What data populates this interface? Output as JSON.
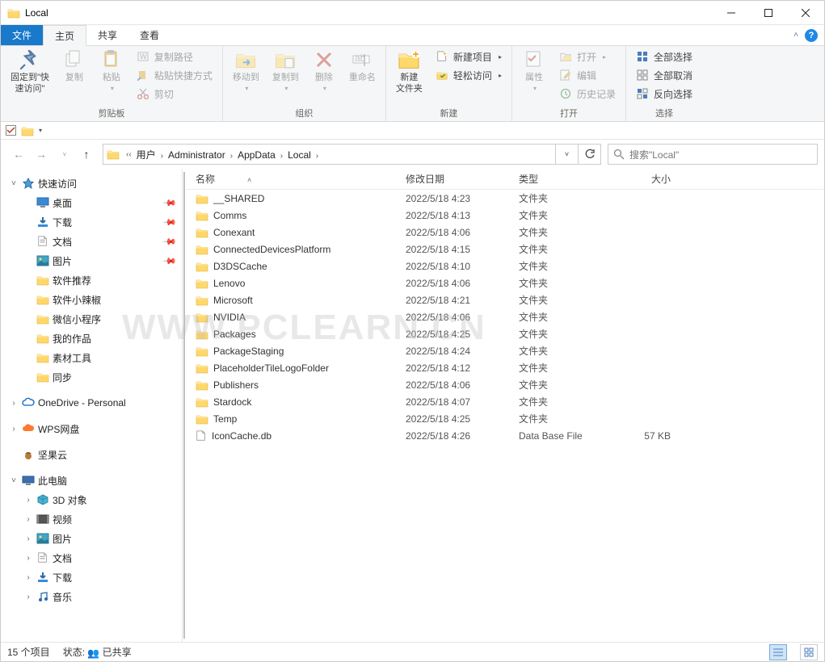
{
  "window": {
    "title": "Local"
  },
  "tabs": {
    "file": "文件",
    "home": "主页",
    "share": "共享",
    "view": "查看"
  },
  "ribbon": {
    "groups": {
      "clipboard": {
        "label": "剪贴板",
        "pin": "固定到\"快\n速访问\"",
        "copy": "复制",
        "paste": "粘贴",
        "copypath": "复制路径",
        "pasteShortcut": "粘贴快捷方式",
        "cut": "剪切"
      },
      "organize": {
        "label": "组织",
        "moveTo": "移动到",
        "copyTo": "复制到",
        "delete": "删除",
        "rename": "重命名"
      },
      "new": {
        "label": "新建",
        "newFolder": "新建\n文件夹",
        "newItem": "新建项目",
        "easyAccess": "轻松访问"
      },
      "open": {
        "label": "打开",
        "properties": "属性",
        "open": "打开",
        "edit": "编辑",
        "history": "历史记录"
      },
      "select": {
        "label": "选择",
        "selectAll": "全部选择",
        "selectNone": "全部取消",
        "invert": "反向选择"
      }
    }
  },
  "breadcrumbs": [
    "用户",
    "Administrator",
    "AppData",
    "Local"
  ],
  "search": {
    "placeholder": "搜索\"Local\""
  },
  "columns": {
    "name": "名称",
    "date": "修改日期",
    "type": "类型",
    "size": "大小"
  },
  "tree": {
    "quickAccess": "快速访问",
    "items": [
      {
        "label": "桌面",
        "icon": "desktop",
        "pinned": true
      },
      {
        "label": "下载",
        "icon": "download",
        "pinned": true
      },
      {
        "label": "文档",
        "icon": "document",
        "pinned": true
      },
      {
        "label": "图片",
        "icon": "pictures",
        "pinned": true
      },
      {
        "label": "软件推荐",
        "icon": "folder",
        "pinned": false
      },
      {
        "label": "软件小辣椒",
        "icon": "folder",
        "pinned": false
      },
      {
        "label": "微信小程序",
        "icon": "folder",
        "pinned": false
      },
      {
        "label": "我的作品",
        "icon": "folder",
        "pinned": false
      },
      {
        "label": "素材工具",
        "icon": "folder",
        "pinned": false
      },
      {
        "label": "同步",
        "icon": "folder",
        "pinned": false
      }
    ],
    "onedrive": "OneDrive - Personal",
    "wps": "WPS网盘",
    "jianguo": "坚果云",
    "thispc": "此电脑",
    "pcItems": [
      {
        "label": "3D 对象",
        "icon": "3d"
      },
      {
        "label": "视频",
        "icon": "video"
      },
      {
        "label": "图片",
        "icon": "pictures"
      },
      {
        "label": "文档",
        "icon": "document"
      },
      {
        "label": "下载",
        "icon": "download"
      },
      {
        "label": "音乐",
        "icon": "music"
      }
    ]
  },
  "files": [
    {
      "name": "__SHARED",
      "date": "2022/5/18 4:23",
      "type": "文件夹",
      "size": "",
      "icon": "folder"
    },
    {
      "name": "Comms",
      "date": "2022/5/18 4:13",
      "type": "文件夹",
      "size": "",
      "icon": "folder"
    },
    {
      "name": "Conexant",
      "date": "2022/5/18 4:06",
      "type": "文件夹",
      "size": "",
      "icon": "folder"
    },
    {
      "name": "ConnectedDevicesPlatform",
      "date": "2022/5/18 4:15",
      "type": "文件夹",
      "size": "",
      "icon": "folder"
    },
    {
      "name": "D3DSCache",
      "date": "2022/5/18 4:10",
      "type": "文件夹",
      "size": "",
      "icon": "folder"
    },
    {
      "name": "Lenovo",
      "date": "2022/5/18 4:06",
      "type": "文件夹",
      "size": "",
      "icon": "folder"
    },
    {
      "name": "Microsoft",
      "date": "2022/5/18 4:21",
      "type": "文件夹",
      "size": "",
      "icon": "folder"
    },
    {
      "name": "NVIDIA",
      "date": "2022/5/18 4:06",
      "type": "文件夹",
      "size": "",
      "icon": "folder"
    },
    {
      "name": "Packages",
      "date": "2022/5/18 4:25",
      "type": "文件夹",
      "size": "",
      "icon": "folder"
    },
    {
      "name": "PackageStaging",
      "date": "2022/5/18 4:24",
      "type": "文件夹",
      "size": "",
      "icon": "folder"
    },
    {
      "name": "PlaceholderTileLogoFolder",
      "date": "2022/5/18 4:12",
      "type": "文件夹",
      "size": "",
      "icon": "folder"
    },
    {
      "name": "Publishers",
      "date": "2022/5/18 4:06",
      "type": "文件夹",
      "size": "",
      "icon": "folder"
    },
    {
      "name": "Stardock",
      "date": "2022/5/18 4:07",
      "type": "文件夹",
      "size": "",
      "icon": "folder"
    },
    {
      "name": "Temp",
      "date": "2022/5/18 4:25",
      "type": "文件夹",
      "size": "",
      "icon": "folder"
    },
    {
      "name": "IconCache.db",
      "date": "2022/5/18 4:26",
      "type": "Data Base File",
      "size": "57 KB",
      "icon": "file"
    }
  ],
  "status": {
    "items": "15 个项目",
    "stateLabel": "状态:",
    "shared": "已共享"
  },
  "watermark": "WWW.PCLEARN.CN"
}
